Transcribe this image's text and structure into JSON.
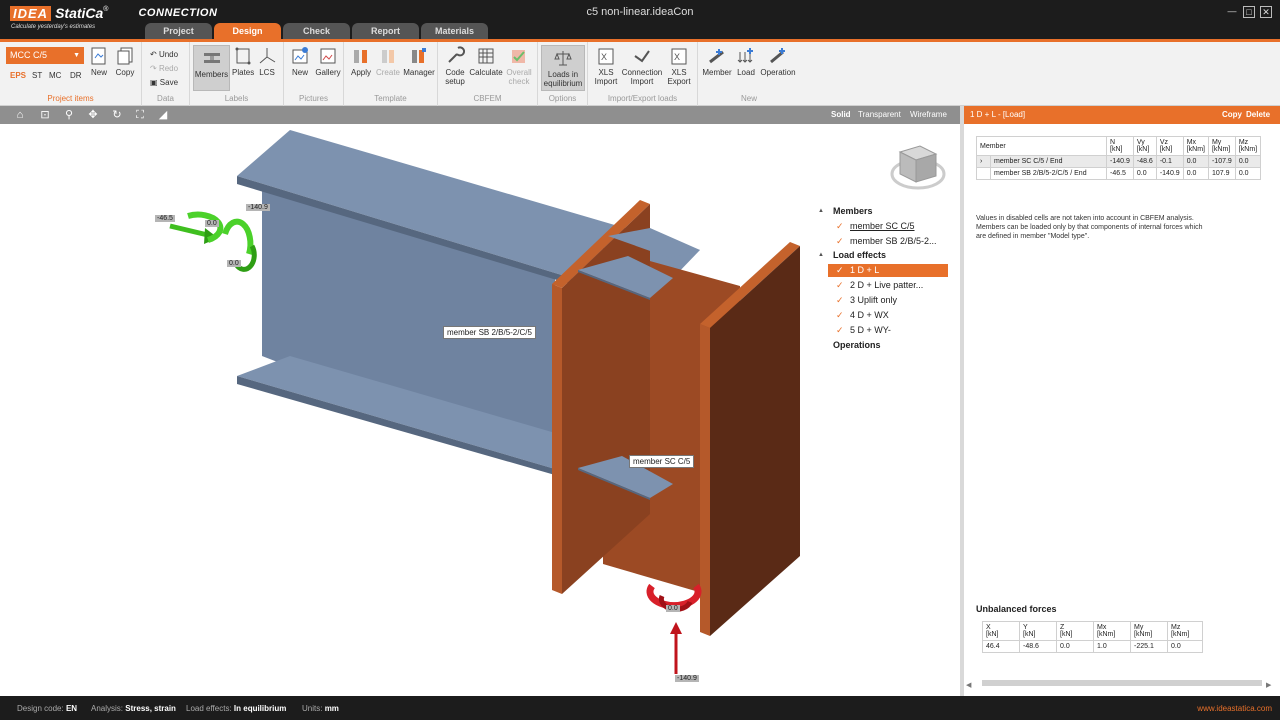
{
  "app": {
    "logo_idea": "IDEA",
    "logo_statica": "StatiCa",
    "logo_reg": "®",
    "logo_product": "CONNECTION",
    "tagline": "Calculate yesterday's estimates",
    "window_title": "c5 non-linear.ideaCon",
    "window_controls": {
      "minimize": "—",
      "maximize": "□",
      "close": "✕"
    }
  },
  "tabs": [
    {
      "label": "Project",
      "active": false
    },
    {
      "label": "Design",
      "active": true
    },
    {
      "label": "Check",
      "active": false
    },
    {
      "label": "Report",
      "active": false
    },
    {
      "label": "Materials",
      "active": false
    }
  ],
  "ribbon": {
    "project_items": {
      "select_value": "MCC C/5",
      "codes": [
        "EPS",
        "ST",
        "MC",
        "DR"
      ],
      "new": "New",
      "copy": "Copy",
      "label": "Project items"
    },
    "data": {
      "undo": "Undo",
      "redo": "Redo",
      "save": "Save",
      "label": "Data"
    },
    "labels": {
      "members": "Members",
      "plates": "Plates",
      "lcs": "LCS",
      "label": "Labels"
    },
    "pictures": {
      "new": "New",
      "gallery": "Gallery",
      "label": "Pictures"
    },
    "template": {
      "apply": "Apply",
      "create": "Create",
      "manager": "Manager",
      "label": "Template"
    },
    "cbfem": {
      "code_setup_1": "Code",
      "code_setup_2": "setup",
      "calculate": "Calculate",
      "overall_1": "Overall",
      "overall_2": "check",
      "label": "CBFEM"
    },
    "options": {
      "loads_1": "Loads in",
      "loads_2": "equilibrium",
      "label": "Options"
    },
    "import_export": {
      "xls_import_1": "XLS",
      "xls_import_2": "Import",
      "conn_import_1": "Connection",
      "conn_import_2": "Import",
      "xls_export_1": "XLS",
      "xls_export_2": "Export",
      "label": "Import/Export loads"
    },
    "new_group": {
      "member": "Member",
      "load": "Load",
      "operation": "Operation",
      "label": "New"
    }
  },
  "view_modes": {
    "solid": "Solid",
    "transparent": "Transparent",
    "wireframe": "Wireframe"
  },
  "scene": {
    "member_label_beam": "member SB 2/B/5-2/C/5",
    "member_label_column": "member SC C/5",
    "force_top_left_a": "-46.5",
    "force_top_left_b": "-140.9",
    "force_top_left_c": "0.0",
    "force_top_left_d": "0.0",
    "force_bottom_a": "0.0",
    "force_bottom_b": "-140.9"
  },
  "tree": {
    "members_head": "Members",
    "members": [
      "member SC C/5",
      "member SB 2/B/5-2..."
    ],
    "load_effects_head": "Load effects",
    "load_effects": [
      "1 D + L",
      "2 D + Live patter...",
      "3 Uplift only",
      "4 D + WX",
      "5 D + WY-"
    ],
    "selected_index": 0,
    "operations_head": "Operations"
  },
  "panel": {
    "title": "1 D + L - [Load]",
    "copy": "Copy",
    "delete": "Delete",
    "table_headers": [
      "Member",
      "N\n[kN]",
      "Vy\n[kN]",
      "Vz\n[kN]",
      "Mx\n[kNm]",
      "My\n[kNm]",
      "Mz\n[kNm]"
    ],
    "rows": [
      {
        "member": "member SC C/5 / End",
        "values": [
          "-140.9",
          "-48.6",
          "-0.1",
          "0.0",
          "-107.9",
          "0.0"
        ],
        "disabled": true
      },
      {
        "member": "member SB 2/B/5-2/C/5 / End",
        "values": [
          "-46.5",
          "0.0",
          "-140.9",
          "0.0",
          "107.9",
          "0.0"
        ],
        "disabled": false
      }
    ],
    "note": "Values in disabled cells are not taken into account in CBFEM analysis. Members can be loaded only by that components of internal forces which are defined in member \"Model type\".",
    "unbalanced_title": "Unbalanced forces",
    "unbalanced_headers": [
      "X\n[kN]",
      "Y\n[kN]",
      "Z\n[kN]",
      "Mx\n[kNm]",
      "My\n[kNm]",
      "Mz\n[kNm]"
    ],
    "unbalanced_values": [
      "46.4",
      "-48.6",
      "0.0",
      "1.0",
      "-225.1",
      "0.0"
    ]
  },
  "status": {
    "design_code_label": "Design code:",
    "design_code": "EN",
    "analysis_label": "Analysis:",
    "analysis": "Stress, strain",
    "load_effects_label": "Load effects:",
    "load_effects": "In equilibrium",
    "units_label": "Units:",
    "units": "mm",
    "site": "www.ideastatica.com"
  },
  "colors": {
    "accent": "#e8702a",
    "beam": "#6f83a0",
    "column": "#9c4a24",
    "force_green": "#3fbf1f",
    "force_red": "#c0141c"
  }
}
